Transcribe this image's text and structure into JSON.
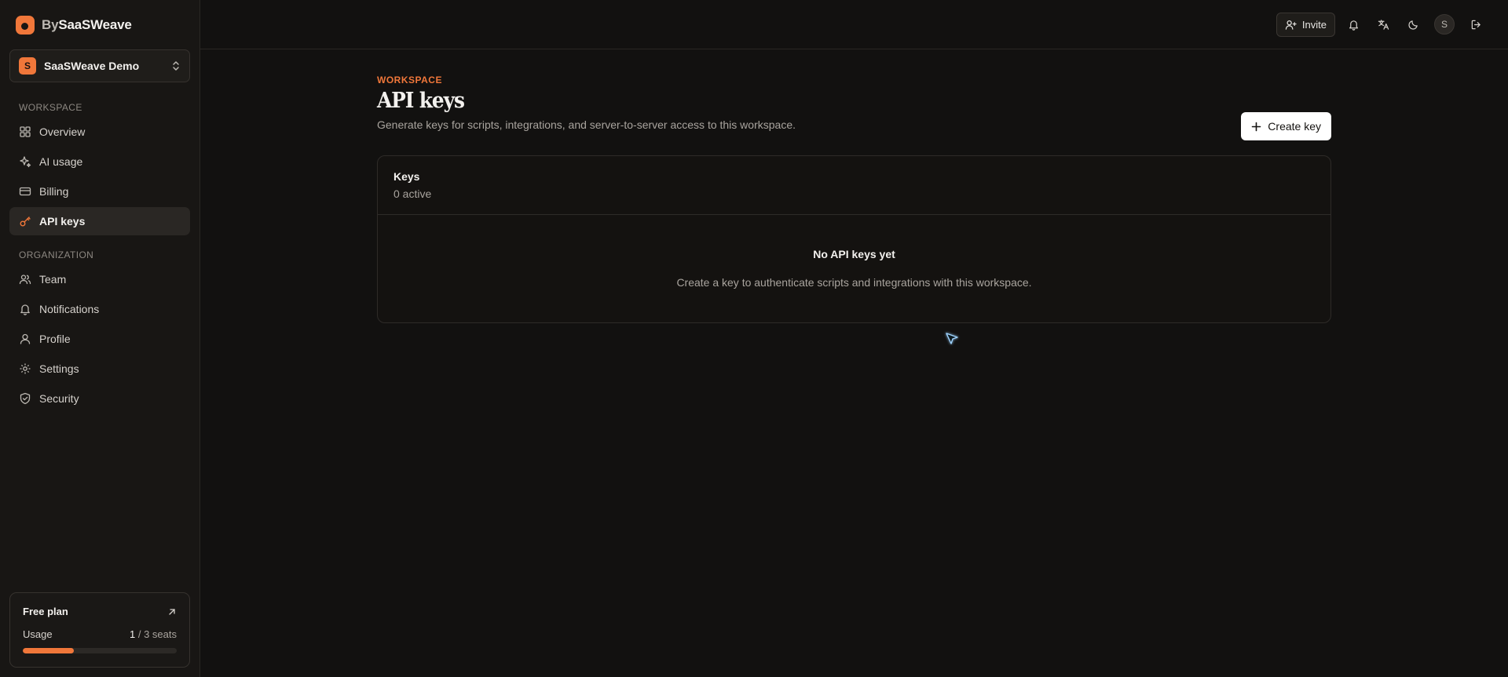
{
  "brand": {
    "prefix": "By",
    "name": "SaaSWeave"
  },
  "workspace_switcher": {
    "initial": "S",
    "name": "SaaSWeave Demo"
  },
  "sidebar": {
    "workspace_heading": "WORKSPACE",
    "workspace_items": [
      {
        "label": "Overview",
        "icon": "grid-icon"
      },
      {
        "label": "AI usage",
        "icon": "sparkles-icon"
      },
      {
        "label": "Billing",
        "icon": "credit-card-icon"
      },
      {
        "label": "API keys",
        "icon": "key-icon",
        "active": true
      }
    ],
    "org_heading": "ORGANIZATION",
    "org_items": [
      {
        "label": "Team",
        "icon": "users-icon"
      },
      {
        "label": "Notifications",
        "icon": "bell-icon"
      },
      {
        "label": "Profile",
        "icon": "user-icon"
      },
      {
        "label": "Settings",
        "icon": "gear-icon"
      },
      {
        "label": "Security",
        "icon": "shield-icon"
      }
    ]
  },
  "plan": {
    "title": "Free plan",
    "usage_label": "Usage",
    "used": "1",
    "separator": "/",
    "total": "3 seats",
    "usage_fraction": 0.33
  },
  "topbar": {
    "invite_label": "Invite",
    "user_initial": "S"
  },
  "page": {
    "eyebrow": "WORKSPACE",
    "title": "API keys",
    "description": "Generate keys for scripts, integrations, and server-to-server access to this workspace.",
    "create_label": "Create key"
  },
  "keys_card": {
    "title": "Keys",
    "count": "0 active",
    "empty_title": "No API keys yet",
    "empty_desc": "Create a key to authenticate scripts and integrations with this workspace."
  },
  "colors": {
    "accent": "#f0773a",
    "background": "#121110",
    "sidebar": "#181614"
  }
}
